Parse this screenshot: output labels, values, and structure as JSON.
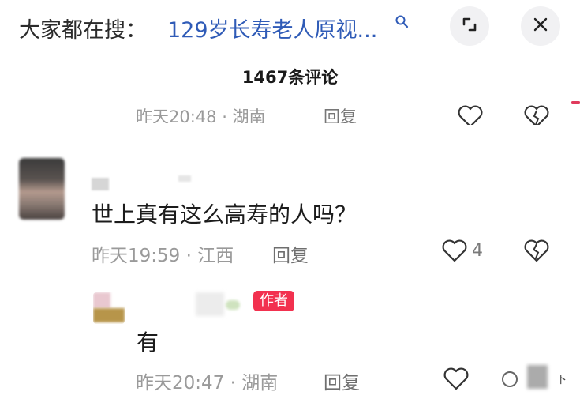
{
  "header": {
    "search_prefix": "大家都在搜：",
    "search_query": "129岁长寿老人原视...",
    "icons": {
      "search": "search-icon",
      "expand": "expand-icon",
      "close": "close-icon"
    }
  },
  "comments_header": {
    "count_label": "1467条评论"
  },
  "previous_reply": {
    "meta": "昨天20:48 · 湖南",
    "reply_label": "回复"
  },
  "main_comment": {
    "text": "世上真有这么高寿的人吗？",
    "meta": "昨天19:59 · 江西",
    "reply_label": "回复",
    "like_count": "4"
  },
  "author_reply": {
    "badge": "作者",
    "text": "有",
    "meta": "昨天20:47 · 湖南",
    "reply_label": "回复"
  },
  "watermark": {
    "text": "下"
  },
  "colors": {
    "link_blue": "#2f5bb7",
    "author_badge": "#f2314f",
    "meta_gray": "#9a9a9a",
    "button_bg": "#f1f1f3"
  }
}
